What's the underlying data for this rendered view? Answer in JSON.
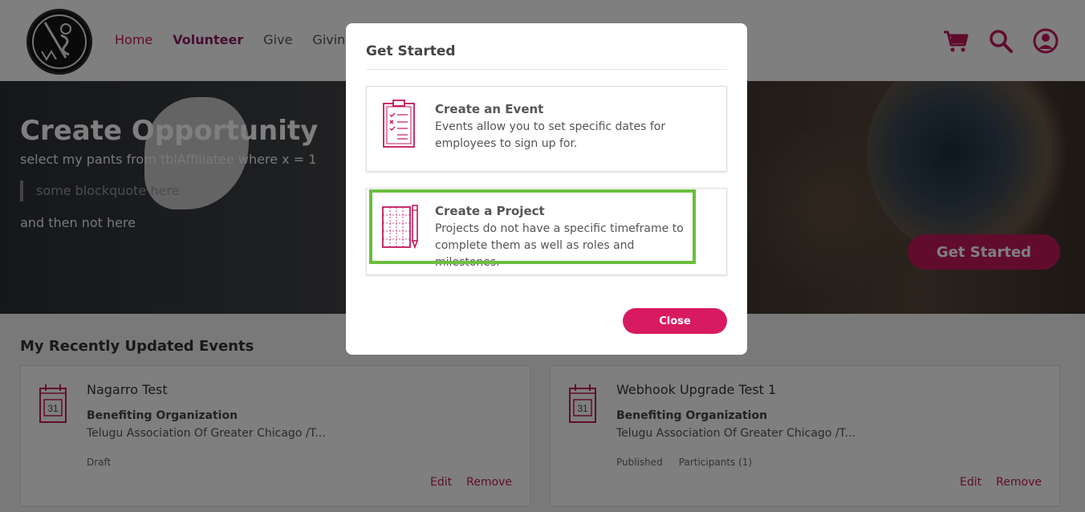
{
  "header": {
    "nav": [
      "Home",
      "Volunteer",
      "Give",
      "Giving C"
    ],
    "icons": [
      "cart-icon",
      "search-icon",
      "user-icon"
    ],
    "accent": "#c2185b"
  },
  "hero": {
    "title": "Create Opportunity",
    "subtitle": "select my pants from tblAffiliatee where x = 1",
    "blockquote": "some blockquote here",
    "after": "and then not here",
    "button": "Get Started"
  },
  "section": {
    "title": "My Recently Updated Events",
    "cards": [
      {
        "title": "Nagarro Test",
        "org_label": "Benefiting Organization",
        "org": "Telugu Association Of Greater Chicago /T...",
        "status": "Draft",
        "participants": "",
        "calendar_day": "31",
        "edit": "Edit",
        "remove": "Remove"
      },
      {
        "title": "Webhook Upgrade Test 1",
        "org_label": "Benefiting Organization",
        "org": "Telugu Association Of Greater Chicago /T...",
        "status": "Published",
        "participants": "Participants (1)",
        "calendar_day": "31",
        "edit": "Edit",
        "remove": "Remove"
      }
    ]
  },
  "modal": {
    "title": "Get Started",
    "options": [
      {
        "title": "Create an Event",
        "description": "Events allow you to set specific dates for employees to sign up for.",
        "icon": "clipboard-checklist-icon"
      },
      {
        "title": "Create a Project",
        "description": "Projects do not have a specific timeframe to complete them as well as roles and milestones.",
        "icon": "grid-paper-pencil-icon"
      }
    ],
    "close_label": "Close",
    "highlight_color": "#6abf3f"
  }
}
